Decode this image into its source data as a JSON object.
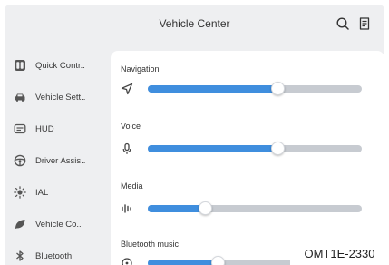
{
  "header": {
    "title": "Vehicle Center",
    "search_icon": "search-icon",
    "settings_icon": "document-icon"
  },
  "sidebar": {
    "items": [
      {
        "label": "Quick Contr..",
        "icon": "quick-control-icon"
      },
      {
        "label": "Vehicle Sett..",
        "icon": "car-icon"
      },
      {
        "label": "HUD",
        "icon": "hud-icon"
      },
      {
        "label": "Driver Assis..",
        "icon": "steering-wheel-icon"
      },
      {
        "label": "IAL",
        "icon": "light-icon"
      },
      {
        "label": "Vehicle Co..",
        "icon": "leaf-icon"
      },
      {
        "label": "Bluetooth",
        "icon": "bluetooth-icon"
      }
    ]
  },
  "volume": {
    "sections": [
      {
        "label": "Navigation",
        "icon": "navigation-arrow-icon",
        "level": 0.61
      },
      {
        "label": "Voice",
        "icon": "microphone-icon",
        "level": 0.61
      },
      {
        "label": "Media",
        "icon": "waveform-icon",
        "level": 0.27
      },
      {
        "label": "Bluetooth music",
        "icon": "music-icon",
        "level": 0.33
      }
    ]
  },
  "figure_code": "OMT1E-2330",
  "colors": {
    "accent": "#3f8ede",
    "track": "#c7cbd1",
    "background": "#eeeff1",
    "panel": "#ffffff"
  }
}
